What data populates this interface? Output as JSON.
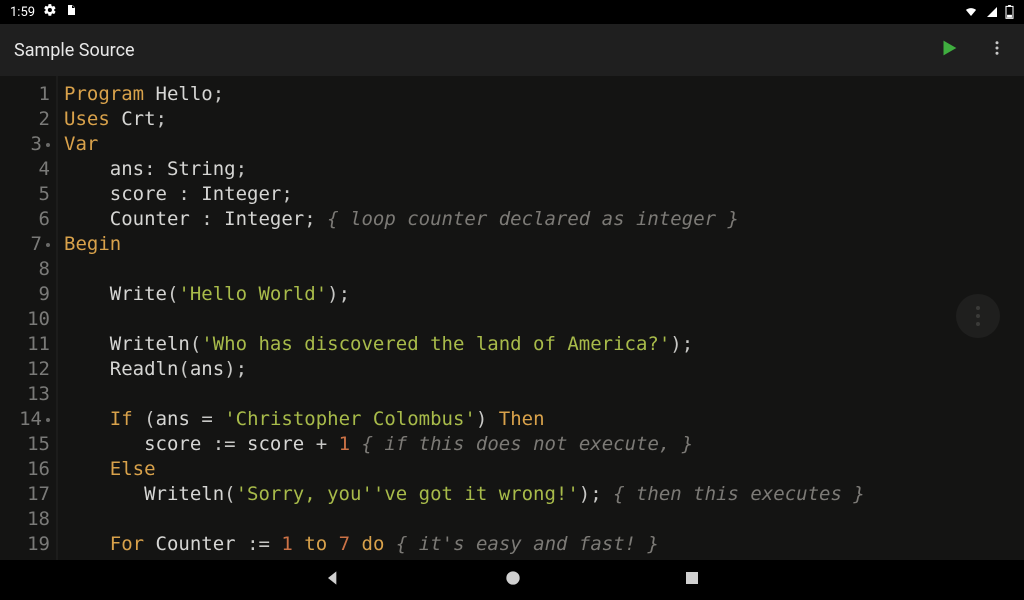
{
  "status": {
    "time": "1:59"
  },
  "appbar": {
    "title": "Sample Source"
  },
  "code": {
    "lines": [
      {
        "n": 1,
        "fold": false,
        "tokens": [
          [
            "kw",
            "Program"
          ],
          [
            "sp",
            " "
          ],
          [
            "ident",
            "Hello"
          ],
          [
            "punc",
            ";"
          ]
        ]
      },
      {
        "n": 2,
        "fold": false,
        "tokens": [
          [
            "kw",
            "Uses"
          ],
          [
            "sp",
            " "
          ],
          [
            "ident",
            "Crt"
          ],
          [
            "punc",
            ";"
          ]
        ]
      },
      {
        "n": 3,
        "fold": true,
        "tokens": [
          [
            "kw",
            "Var"
          ]
        ]
      },
      {
        "n": 4,
        "fold": false,
        "tokens": [
          [
            "sp",
            "    "
          ],
          [
            "ident",
            "ans"
          ],
          [
            "punc",
            ": "
          ],
          [
            "type",
            "String"
          ],
          [
            "punc",
            ";"
          ]
        ]
      },
      {
        "n": 5,
        "fold": false,
        "tokens": [
          [
            "sp",
            "    "
          ],
          [
            "ident",
            "score"
          ],
          [
            "punc",
            " : "
          ],
          [
            "type",
            "Integer"
          ],
          [
            "punc",
            ";"
          ]
        ]
      },
      {
        "n": 6,
        "fold": false,
        "tokens": [
          [
            "sp",
            "    "
          ],
          [
            "ident",
            "Counter"
          ],
          [
            "punc",
            " : "
          ],
          [
            "type",
            "Integer"
          ],
          [
            "punc",
            "; "
          ],
          [
            "cmt",
            "{ loop counter declared as integer }"
          ]
        ]
      },
      {
        "n": 7,
        "fold": true,
        "tokens": [
          [
            "kw",
            "Begin"
          ]
        ]
      },
      {
        "n": 8,
        "fold": false,
        "tokens": []
      },
      {
        "n": 9,
        "fold": false,
        "tokens": [
          [
            "sp",
            "    "
          ],
          [
            "ident",
            "Write"
          ],
          [
            "punc",
            "("
          ],
          [
            "str",
            "'Hello World'"
          ],
          [
            "punc",
            ");"
          ]
        ]
      },
      {
        "n": 10,
        "fold": false,
        "tokens": []
      },
      {
        "n": 11,
        "fold": false,
        "tokens": [
          [
            "sp",
            "    "
          ],
          [
            "ident",
            "Writeln"
          ],
          [
            "punc",
            "("
          ],
          [
            "str",
            "'Who has discovered the land of America?'"
          ],
          [
            "punc",
            ");"
          ]
        ]
      },
      {
        "n": 12,
        "fold": false,
        "tokens": [
          [
            "sp",
            "    "
          ],
          [
            "ident",
            "Readln"
          ],
          [
            "punc",
            "("
          ],
          [
            "ident",
            "ans"
          ],
          [
            "punc",
            ");"
          ]
        ]
      },
      {
        "n": 13,
        "fold": false,
        "tokens": []
      },
      {
        "n": 14,
        "fold": true,
        "tokens": [
          [
            "sp",
            "    "
          ],
          [
            "kw",
            "If"
          ],
          [
            "sp",
            " "
          ],
          [
            "punc",
            "("
          ],
          [
            "ident",
            "ans"
          ],
          [
            "punc",
            " = "
          ],
          [
            "str",
            "'Christopher Colombus'"
          ],
          [
            "punc",
            ") "
          ],
          [
            "kw",
            "Then"
          ]
        ]
      },
      {
        "n": 15,
        "fold": false,
        "tokens": [
          [
            "sp",
            "       "
          ],
          [
            "ident",
            "score"
          ],
          [
            "punc",
            " := "
          ],
          [
            "ident",
            "score"
          ],
          [
            "punc",
            " + "
          ],
          [
            "num",
            "1"
          ],
          [
            "sp",
            " "
          ],
          [
            "cmt",
            "{ if this does not execute, }"
          ]
        ]
      },
      {
        "n": 16,
        "fold": false,
        "tokens": [
          [
            "sp",
            "    "
          ],
          [
            "kw",
            "Else"
          ]
        ]
      },
      {
        "n": 17,
        "fold": false,
        "tokens": [
          [
            "sp",
            "       "
          ],
          [
            "ident",
            "Writeln"
          ],
          [
            "punc",
            "("
          ],
          [
            "str",
            "'Sorry, you''ve got it wrong!'"
          ],
          [
            "punc",
            "); "
          ],
          [
            "cmt",
            "{ then this executes }"
          ]
        ]
      },
      {
        "n": 18,
        "fold": false,
        "tokens": []
      },
      {
        "n": 19,
        "fold": false,
        "tokens": [
          [
            "sp",
            "    "
          ],
          [
            "kw",
            "For"
          ],
          [
            "sp",
            " "
          ],
          [
            "ident",
            "Counter"
          ],
          [
            "punc",
            " := "
          ],
          [
            "num",
            "1"
          ],
          [
            "punc",
            " "
          ],
          [
            "kw",
            "to"
          ],
          [
            "punc",
            " "
          ],
          [
            "num",
            "7"
          ],
          [
            "punc",
            " "
          ],
          [
            "kw",
            "do"
          ],
          [
            "sp",
            " "
          ],
          [
            "cmt",
            "{ it's easy and fast! }"
          ]
        ]
      }
    ]
  }
}
